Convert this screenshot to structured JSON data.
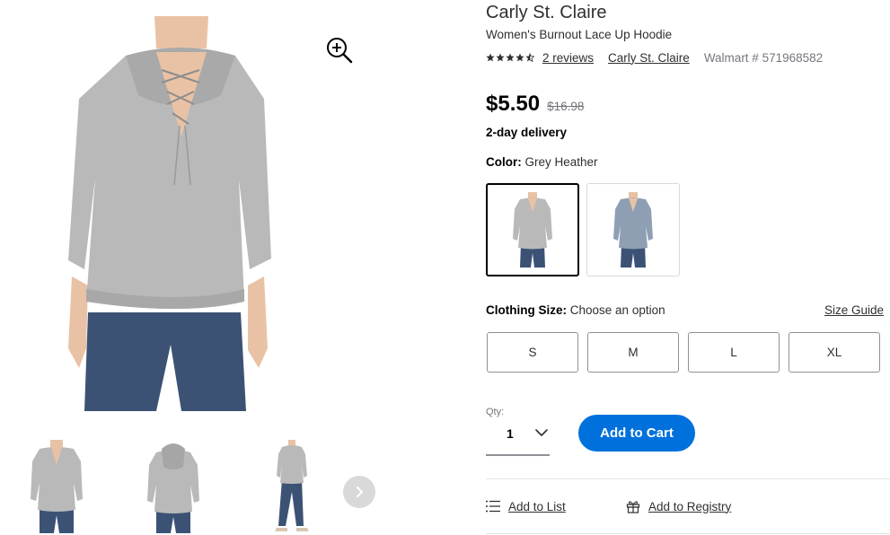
{
  "product": {
    "brand": "Carly St. Claire",
    "name": "Women's Burnout Lace Up Hoodie",
    "rating": 4.5,
    "reviews_label": "2 reviews",
    "brand_link": "Carly St. Claire",
    "walmart_number": "Walmart # 571968582"
  },
  "pricing": {
    "price": "$5.50",
    "was_price": "$16.98",
    "delivery": "2-day delivery"
  },
  "color": {
    "label": "Color:",
    "selected": "Grey Heather",
    "swatches": [
      {
        "name": "Grey Heather",
        "hex": "#b9b9b9",
        "selected": true
      },
      {
        "name": "Blue Heather",
        "hex": "#8e9fb4",
        "selected": false
      }
    ]
  },
  "size": {
    "label": "Clothing Size:",
    "prompt": "Choose an option",
    "guide": "Size Guide",
    "options": [
      "S",
      "M",
      "L",
      "XL"
    ]
  },
  "quantity": {
    "label": "Qty:",
    "value": "1"
  },
  "actions": {
    "add_to_cart": "Add to Cart",
    "add_to_list": "Add to List",
    "add_to_registry": "Add to Registry"
  },
  "colors": {
    "accent": "#0071dc",
    "text": "#2e2f32",
    "muted": "#74767c",
    "hoodie": "#b9b9b9",
    "jeans": "#3c5275"
  }
}
